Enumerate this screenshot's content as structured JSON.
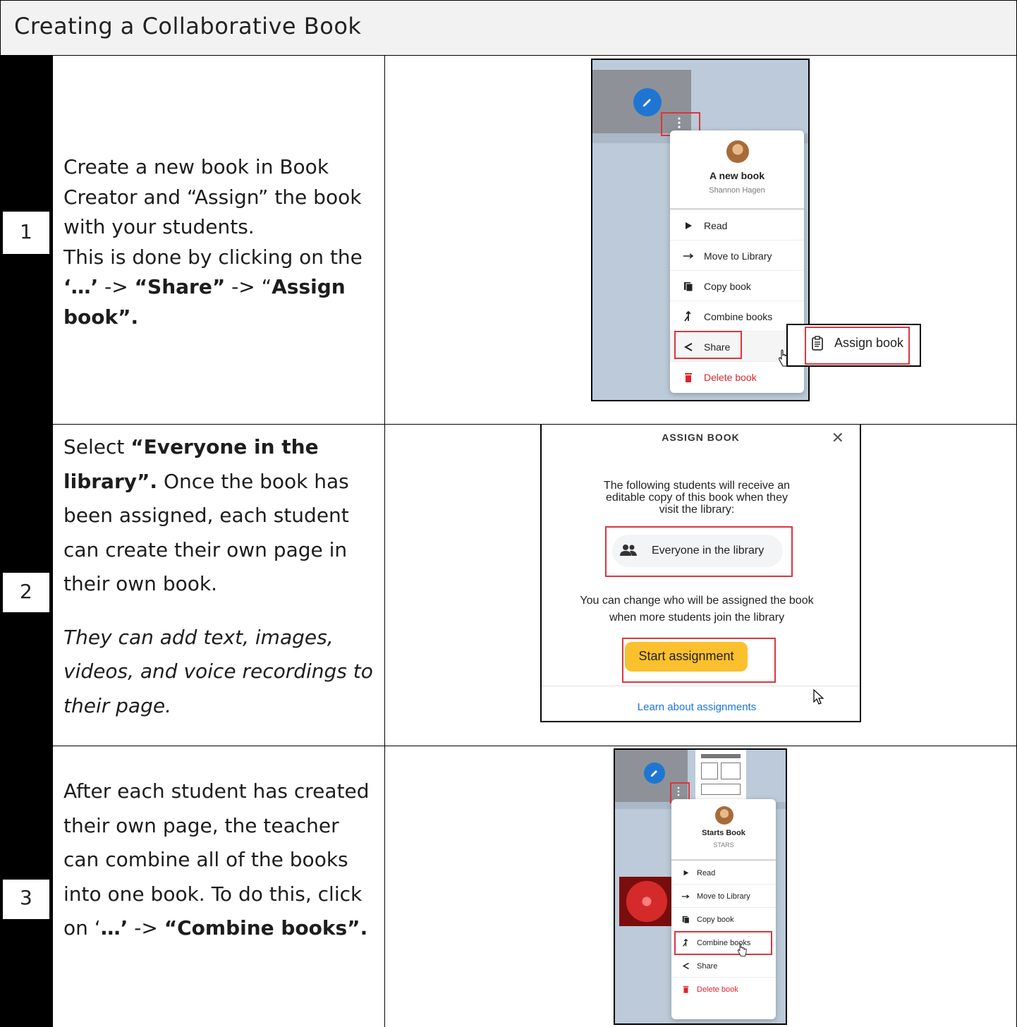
{
  "title": "Creating a Collaborative Book",
  "steps": [
    {
      "number": "1",
      "lines": [
        "Create a new book in Book",
        "Creator and “Assign” the book",
        "with your students.",
        "This is done  by clicking on the"
      ],
      "bold_line_a": "‘…’",
      "arrow_a": " -> ",
      "bold_line_b": "“Share”",
      "arrow_b": " -> “",
      "bold_line_c": "Assign",
      "bold_line_d": "book”."
    },
    {
      "number": "2",
      "select": "Select ",
      "bold_a": "“Everyone in the",
      "bold_b": "library”.",
      "rest": "  Once the book has",
      "line3": "been assigned, each student",
      "line4": "can create their own page in",
      "line5": "their own book.",
      "italic_lines": [
        "They can add text, images,",
        "videos, and voice recordings to",
        "their page."
      ]
    },
    {
      "number": "3",
      "lines": [
        "After each student has created",
        "their own page, the teacher",
        "can combine all of the books",
        "into one book. To do this, click"
      ],
      "on": "on ‘",
      "dots": "…’",
      "arrow": " -> ",
      "bold_end": "“Combine books”."
    }
  ],
  "shot1": {
    "book_title": "A new book",
    "author": "Shannon Hagen",
    "menu": [
      "Read",
      "Move to Library",
      "Copy book",
      "Combine books",
      "Share",
      "Delete book"
    ],
    "assign_label": "Assign book",
    "colors": {
      "danger": "#e0242b",
      "highlight": "#d9363e"
    }
  },
  "shot2": {
    "heading": "ASSIGN BOOK",
    "close": "✕",
    "desc_lines": [
      "The following students will receive an",
      "editable copy of this book when they",
      "visit the library:"
    ],
    "everyone": "Everyone in the library",
    "note_lines": [
      "You can change who will be assigned the book",
      "when more students join the library"
    ],
    "start_button": "Start assignment",
    "learn_link": "Learn about assignments",
    "colors": {
      "button": "#fbc02d",
      "link": "#1a73e8"
    }
  },
  "shot3": {
    "book_title": "Starts Book",
    "author": "STARS",
    "menu": [
      "Read",
      "Move to Library",
      "Copy book",
      "Combine books",
      "Share",
      "Delete book"
    ]
  }
}
